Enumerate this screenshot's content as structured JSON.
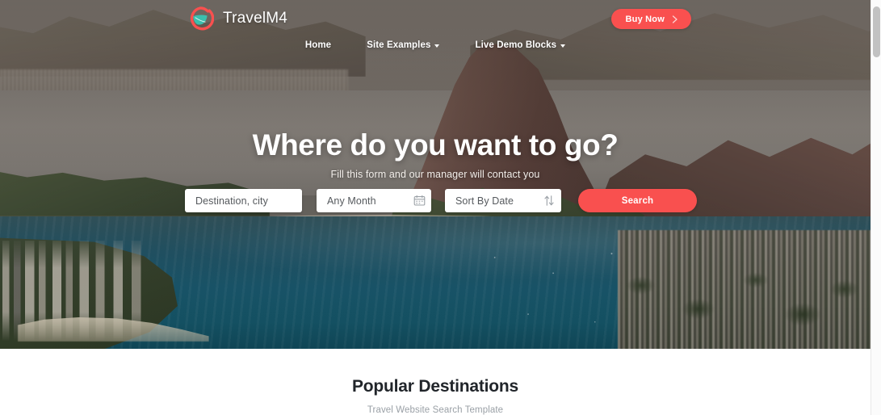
{
  "brand": {
    "name": "TravelM4",
    "logo_icon": "leaf-in-circle-logo",
    "logo_circle_color": "#f9504f",
    "logo_leaf_color": "#3bbfae"
  },
  "topbar": {
    "buy_now_label": "Buy Now",
    "buy_now_icon": "chevron-right-icon",
    "buy_now_color": "#f9504f"
  },
  "nav": {
    "items": [
      {
        "label": "Home",
        "has_caret": false
      },
      {
        "label": "Site Examples",
        "has_caret": true
      },
      {
        "label": "Live Demo Blocks",
        "has_caret": true
      }
    ]
  },
  "hero": {
    "title": "Where do you want to go?",
    "subtitle": "Fill this form and our manager will contact you",
    "image_description": "Aerial view of Rio de Janeiro with Sugarloaf Mountain and Guanabara Bay"
  },
  "search_form": {
    "destination": {
      "value": "",
      "placeholder": "Destination, city",
      "icon": "search-icon"
    },
    "month": {
      "value": "Any Month",
      "icon": "calendar-icon"
    },
    "sort": {
      "value": "Sort By Date",
      "icon": "sort-arrows-icon"
    },
    "submit_label": "Search",
    "submit_color": "#f9504f"
  },
  "section": {
    "title": "Popular Destinations",
    "subtitle": "Travel Website Search Template"
  },
  "scrollbar": {
    "orientation": "vertical",
    "thumb_position_percent": 2
  }
}
